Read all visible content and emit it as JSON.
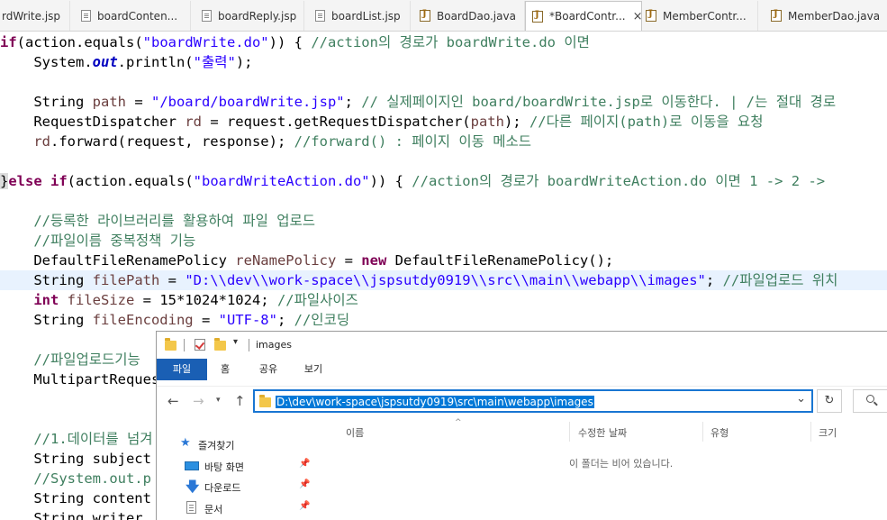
{
  "tabs": [
    {
      "label": "rdWrite.jsp",
      "icon": "jsp-file-icon",
      "active": false
    },
    {
      "label": "boardConten...",
      "icon": "jsp-file-icon",
      "active": false
    },
    {
      "label": "boardReply.jsp",
      "icon": "jsp-file-icon",
      "active": false
    },
    {
      "label": "boardList.jsp",
      "icon": "jsp-file-icon",
      "active": false
    },
    {
      "label": "BoardDao.java",
      "icon": "java-file-icon",
      "active": false
    },
    {
      "label": "*BoardContr...",
      "icon": "java-file-icon",
      "active": true,
      "close": "×"
    },
    {
      "label": "MemberContr...",
      "icon": "java-file-icon",
      "active": false
    },
    {
      "label": "MemberDao.java",
      "icon": "java-file-icon",
      "active": false
    }
  ],
  "code": [
    [
      [
        "kw",
        "if"
      ],
      [
        "",
        "(action.equals("
      ],
      [
        "str",
        "\"boardWrite.do\""
      ],
      [
        "",
        ")) { "
      ],
      [
        "cm",
        "//action의 경로가 boardWrite.do 이면"
      ]
    ],
    [
      [
        "",
        "    System."
      ],
      [
        "fld",
        "out"
      ],
      [
        "",
        ".println("
      ],
      [
        "str",
        "\"출력\""
      ],
      [
        "",
        ");"
      ]
    ],
    [],
    [
      [
        "",
        "    String "
      ],
      [
        "var",
        "path"
      ],
      [
        "",
        " = "
      ],
      [
        "str",
        "\"/board/boardWrite.jsp\""
      ],
      [
        "",
        "; "
      ],
      [
        "cm",
        "// 실제페이지인 board/boardWrite.jsp로 이동한다. | /는 절대 경로"
      ]
    ],
    [
      [
        "",
        "    RequestDispatcher "
      ],
      [
        "var",
        "rd"
      ],
      [
        "",
        " = request.getRequestDispatcher("
      ],
      [
        "var",
        "path"
      ],
      [
        "",
        "); "
      ],
      [
        "cm",
        "//다른 페이지(path)로 이동을 요청"
      ]
    ],
    [
      [
        "",
        "    "
      ],
      [
        "var",
        "rd"
      ],
      [
        "",
        ".forward(request, response); "
      ],
      [
        "cm",
        "//forward() : 페이지 이동 메소드"
      ]
    ],
    [],
    [
      [
        "brk",
        "}"
      ],
      [
        "kw",
        "else if"
      ],
      [
        "",
        "(action.equals("
      ],
      [
        "str",
        "\"boardWriteAction.do\""
      ],
      [
        "",
        ")) { "
      ],
      [
        "cm",
        "//action의 경로가 boardWriteAction.do 이면 1 -> 2 ->"
      ]
    ],
    [],
    [
      [
        "",
        "    "
      ],
      [
        "cm",
        "//등록한 라이브러리를 활용하여 파일 업로드"
      ]
    ],
    [
      [
        "",
        "    "
      ],
      [
        "cm",
        "//파일이름 중복정책 기능"
      ]
    ],
    [
      [
        "",
        "    DefaultFileRenamePolicy "
      ],
      [
        "var",
        "reNamePolicy"
      ],
      [
        "",
        " = "
      ],
      [
        "kw",
        "new"
      ],
      [
        "",
        " DefaultFileRenamePolicy();"
      ]
    ],
    [
      [
        "",
        "    String "
      ],
      [
        "var",
        "filePath"
      ],
      [
        "",
        " = "
      ],
      [
        "str",
        "\"D:\\\\dev\\\\work-space\\\\jspsutdy0919\\\\src\\\\main\\\\webapp\\\\images\""
      ],
      [
        "",
        "; "
      ],
      [
        "cm",
        "//파일업로드 위치"
      ]
    ],
    [
      [
        "",
        "    "
      ],
      [
        "kw",
        "int"
      ],
      [
        "",
        " "
      ],
      [
        "var",
        "fileSize"
      ],
      [
        "",
        " = 15*1024*1024; "
      ],
      [
        "cm",
        "//파일사이즈"
      ]
    ],
    [
      [
        "",
        "    String "
      ],
      [
        "var",
        "fileEncoding"
      ],
      [
        "",
        " = "
      ],
      [
        "str",
        "\"UTF-8\""
      ],
      [
        "",
        "; "
      ],
      [
        "cm",
        "//인코딩"
      ]
    ],
    [],
    [
      [
        "",
        "    "
      ],
      [
        "cm",
        "//파일업로드기능"
      ]
    ],
    [
      [
        "",
        "    MultipartRequest"
      ]
    ],
    [],
    [],
    [
      [
        "",
        "    "
      ],
      [
        "cm",
        "//1.데이터를 넘겨"
      ]
    ],
    [
      [
        "",
        "    String subject"
      ]
    ],
    [
      [
        "",
        "    "
      ],
      [
        "cm",
        "//System.out.p"
      ]
    ],
    [
      [
        "",
        "    String content"
      ]
    ],
    [
      [
        "",
        "    String writer"
      ]
    ]
  ],
  "explorer": {
    "title": "images",
    "ribbon_tabs": [
      "파일",
      "홈",
      "공유",
      "보기"
    ],
    "address": "D:\\dev\\work-space\\jspsutdy0919\\src\\main\\webapp\\images",
    "nav_items": [
      {
        "label": "즐겨찾기",
        "icon": "star-icon"
      },
      {
        "label": "바탕 화면",
        "icon": "desktop-icon"
      },
      {
        "label": "다운로드",
        "icon": "download-icon"
      },
      {
        "label": "문서",
        "icon": "document-icon"
      }
    ],
    "columns": [
      "이름",
      "수정한 날짜",
      "유형",
      "크기"
    ],
    "empty_message": "이 폴더는 비어 있습니다."
  }
}
